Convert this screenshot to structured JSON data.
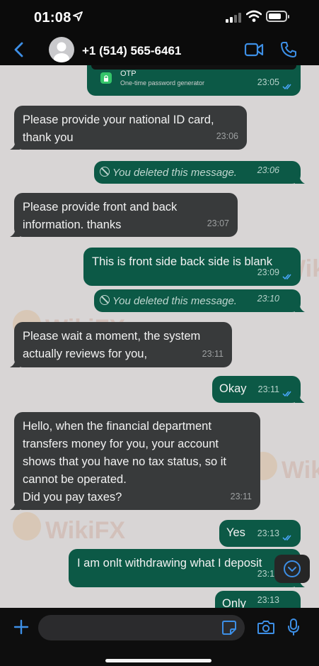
{
  "status_bar": {
    "time": "01:08"
  },
  "header": {
    "contact": "+1 (514) 565-6461"
  },
  "otp_card": {
    "title": "OTP",
    "subtitle": "One-time password generator",
    "time": "23:05"
  },
  "messages": [
    {
      "dir": "in",
      "text": "Please provide your national ID card,\nthank you",
      "time": "23:06"
    },
    {
      "dir": "out",
      "deleted": true,
      "text": "You deleted this message.",
      "time": "23:06"
    },
    {
      "dir": "in",
      "text": "Please provide front and back\ninformation. thanks",
      "time": "23:07"
    },
    {
      "dir": "out",
      "text": "This is front side back side is blank",
      "time": "23:09"
    },
    {
      "dir": "out",
      "deleted": true,
      "text": "You deleted this message.",
      "time": "23:10"
    },
    {
      "dir": "in",
      "text": "Please wait a moment, the system\nactually reviews for you,",
      "time": "23:11"
    },
    {
      "dir": "out",
      "text": "Okay",
      "time": "23:11"
    },
    {
      "dir": "in",
      "text": "Hello, when the financial department\ntransfers money for you, your account\nshows that you have no tax status, so it\ncannot be operated.\nDid you pay taxes?",
      "time": "23:11"
    },
    {
      "dir": "out",
      "text": "Yes",
      "time": "23:13"
    },
    {
      "dir": "out",
      "text": "I am onlt withdrawing what I deposit",
      "time": "23:13"
    },
    {
      "dir": "out",
      "text": "Only",
      "time": "23:13"
    }
  ],
  "watermark": {
    "text": "WikiFX"
  },
  "composer": {
    "placeholder": ""
  },
  "colors": {
    "incoming_bubble": "#383a3b",
    "outgoing_bubble": "#0c5946",
    "chat_bg": "#d8d5d5",
    "accent_blue": "#3d8fe6"
  },
  "icons": [
    "location-arrow-icon",
    "signal-icon",
    "wifi-icon",
    "battery-icon",
    "back-chevron-icon",
    "video-call-icon",
    "phone-call-icon",
    "double-check-icon",
    "deleted-icon",
    "chevron-down-icon",
    "plus-icon",
    "sticker-icon",
    "camera-icon",
    "microphone-icon"
  ]
}
